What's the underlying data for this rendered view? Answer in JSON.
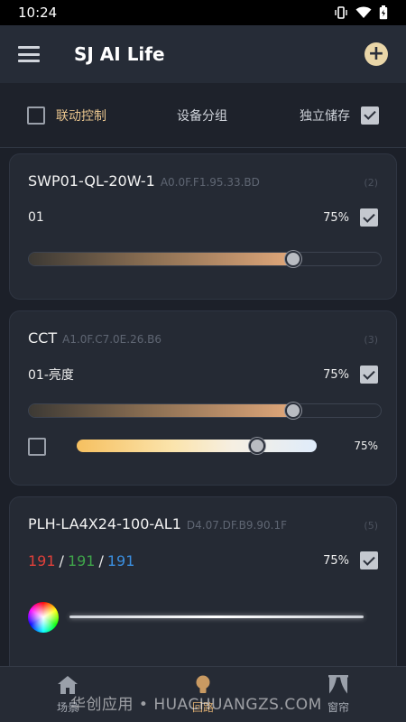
{
  "status_bar": {
    "time": "10:24"
  },
  "app_bar": {
    "title": "SJ AI Life",
    "add_label": "+"
  },
  "options": {
    "linkage_label": "联动控制",
    "linkage_checked": false,
    "group_label": "设备分组",
    "store_label": "独立储存",
    "store_checked": true
  },
  "devices": [
    {
      "name": "SWP01-QL-20W-1",
      "address": "A0.0F.F1.95.33.BD",
      "index": "(2)",
      "channel": "01",
      "percent": "75%",
      "checked": true,
      "level": 0.75
    },
    {
      "name": "CCT",
      "address": "A1.0F.C7.0E.26.B6",
      "index": "(3)",
      "channel": "01-亮度",
      "percent": "75%",
      "checked": true,
      "level": 0.75,
      "cct_checked": false,
      "cct_percent": "75%",
      "cct_level": 0.75
    },
    {
      "name": "PLH-LA4X24-100-AL1",
      "address": "D4.07.DF.B9.90.1F",
      "index": "(5)",
      "rgb": {
        "r": "191",
        "g": "191",
        "b": "191",
        "sep": "/"
      },
      "percent": "75%",
      "checked": true
    }
  ],
  "bottom_nav": [
    {
      "label": "场景",
      "icon": "home-icon",
      "active": false
    },
    {
      "label": "回路",
      "icon": "bulb-icon",
      "active": true
    },
    {
      "label": "窗帘",
      "icon": "curtain-icon",
      "active": false
    }
  ],
  "watermark": "华创应用 • HUACHUANGZS.COM"
}
